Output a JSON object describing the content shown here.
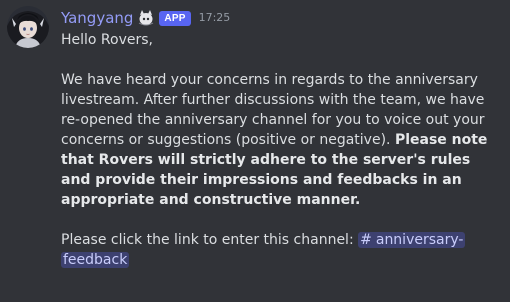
{
  "message": {
    "author": {
      "name": "Yangyang",
      "app_tag": "APP",
      "timestamp": "17:25",
      "avatar_icon": "anime-character-avatar",
      "role_icon": "bot-mascot-icon",
      "name_color": "#949cf7"
    },
    "body": {
      "greeting": "Hello Rovers,",
      "paragraph_text": "We have heard your concerns in regards to the anniversary livestream. After further discussions with the team, we have re-opened the anniversary channel for you to voice out your concerns or suggestions (positive or negative). ",
      "paragraph_bold": "Please note that Rovers will strictly adhere to the server's rules and provide their impressions and feedbacks in an appropriate and constructive manner.",
      "link_prompt": "Please click the link to enter this channel: ",
      "channel_mention": {
        "hash": "#",
        "name": "anniversary-feedback"
      }
    }
  },
  "colors": {
    "background": "#313338",
    "text": "#dbdee1",
    "app_tag_bg": "#5865f2",
    "timestamp": "#949ba4",
    "mention_bg": "rgba(88,101,242,0.30)",
    "mention_text": "#c9cdfb"
  }
}
